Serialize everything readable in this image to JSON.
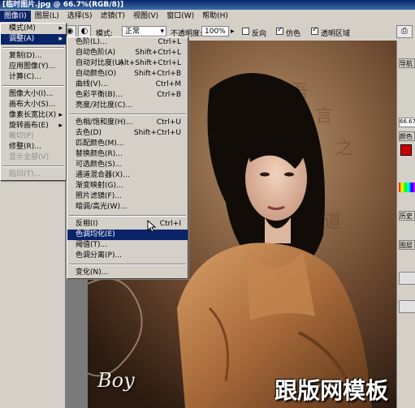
{
  "window": {
    "title": "[临时图片.jpg @ 66.7%(RGB/8)]"
  },
  "menubar": {
    "items": [
      "图像(I)",
      "图层(L)",
      "选择(S)",
      "滤镜(T)",
      "视图(V)",
      "窗口(W)",
      "帮助(H)"
    ]
  },
  "options": {
    "mode_label": "模式:",
    "mode_value": "正常",
    "opacity_label": "不透明度:",
    "opacity_value": "100%",
    "reverse_label": "反向",
    "dither_label": "仿色",
    "transparency_label": "透明区域"
  },
  "image_menu": {
    "items": [
      {
        "label": "模式(M)",
        "submenu": true,
        "disabled": false
      },
      {
        "label": "调整(A)",
        "submenu": true,
        "disabled": false,
        "highlight": true
      },
      {
        "sep": true
      },
      {
        "label": "复制(D)...",
        "disabled": false
      },
      {
        "label": "应用图像(Y)...",
        "disabled": false
      },
      {
        "label": "计算(C)...",
        "disabled": false
      },
      {
        "sep": true
      },
      {
        "label": "图像大小(I)...",
        "disabled": false
      },
      {
        "label": "画布大小(S)...",
        "disabled": false
      },
      {
        "label": "像素长宽比(X)",
        "submenu": true,
        "disabled": false
      },
      {
        "label": "旋转画布(E)",
        "submenu": true,
        "disabled": false
      },
      {
        "label": "裁切(P)",
        "disabled": true
      },
      {
        "label": "修整(R)...",
        "disabled": false
      },
      {
        "label": "显示全部(V)",
        "disabled": true
      },
      {
        "sep": true
      },
      {
        "label": "陷印(T)...",
        "disabled": true
      }
    ]
  },
  "adjust_menu": {
    "items": [
      {
        "label": "色阶(L)...",
        "shortcut": "Ctrl+L"
      },
      {
        "label": "自动色阶(A)",
        "shortcut": "Shift+Ctrl+L"
      },
      {
        "label": "自动对比度(U)",
        "shortcut": "Alt+Shift+Ctrl+L"
      },
      {
        "label": "自动颜色(O)",
        "shortcut": "Shift+Ctrl+B"
      },
      {
        "label": "曲线(V)...",
        "shortcut": "Ctrl+M"
      },
      {
        "label": "色彩平衡(B)...",
        "shortcut": "Ctrl+B"
      },
      {
        "label": "亮度/对比度(C)...",
        "shortcut": ""
      },
      {
        "sep": true
      },
      {
        "label": "色相/饱和度(H)...",
        "shortcut": "Ctrl+U"
      },
      {
        "label": "去色(D)",
        "shortcut": "Shift+Ctrl+U"
      },
      {
        "label": "匹配颜色(M)...",
        "shortcut": ""
      },
      {
        "label": "替换颜色(R)...",
        "shortcut": ""
      },
      {
        "label": "可选颜色(S)...",
        "shortcut": ""
      },
      {
        "label": "通道混合器(X)...",
        "shortcut": ""
      },
      {
        "label": "渐变映射(G)...",
        "shortcut": ""
      },
      {
        "label": "照片滤镜(F)...",
        "shortcut": ""
      },
      {
        "label": "暗调/高光(W)...",
        "shortcut": ""
      },
      {
        "sep": true
      },
      {
        "label": "反相(I)",
        "shortcut": "Ctrl+I"
      },
      {
        "label": "色调均化(E)",
        "shortcut": "",
        "highlight": true
      },
      {
        "label": "阈值(T)...",
        "shortcut": ""
      },
      {
        "label": "色调分离(P)...",
        "shortcut": ""
      },
      {
        "sep": true
      },
      {
        "label": "变化(N)...",
        "shortcut": ""
      }
    ]
  },
  "right_panel": {
    "tabs": [
      "导航",
      "颜色",
      "历史",
      "图层"
    ],
    "zoom_readout": "66.67"
  },
  "canvas": {
    "signature": "Boy",
    "watermark": "跟版网模板"
  },
  "colors": {
    "menu_bg": "#d4d0c8",
    "highlight": "#0a246a",
    "title_grad_start": "#0a246a"
  }
}
